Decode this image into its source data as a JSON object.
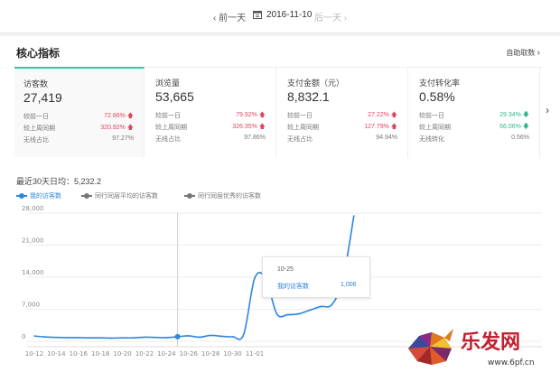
{
  "datebar": {
    "prev": "前一天",
    "date": "2016-11-10",
    "next": "后一天"
  },
  "panel": {
    "title": "核心指标",
    "custom": "自助取数"
  },
  "metrics": [
    {
      "name": "访客数",
      "value": "27,419",
      "rows": [
        {
          "label": "较前一日",
          "value": "72.86%",
          "dir": "up"
        },
        {
          "label": "较上周同期",
          "value": "320.92%",
          "dir": "up"
        },
        {
          "label": "无线占比",
          "value": "97.27%",
          "dir": "none"
        }
      ]
    },
    {
      "name": "浏览量",
      "value": "53,665",
      "rows": [
        {
          "label": "较前一日",
          "value": "79.92%",
          "dir": "up"
        },
        {
          "label": "较上周同期",
          "value": "326.35%",
          "dir": "up"
        },
        {
          "label": "无线占比",
          "value": "97.86%",
          "dir": "none"
        }
      ]
    },
    {
      "name": "支付金额（元）",
      "value": "8,832.1",
      "rows": [
        {
          "label": "较前一日",
          "value": "27.22%",
          "dir": "up"
        },
        {
          "label": "较上周同期",
          "value": "127.79%",
          "dir": "up"
        },
        {
          "label": "无线占比",
          "value": "94.94%",
          "dir": "none"
        }
      ]
    },
    {
      "name": "支付转化率",
      "value": "0.58%",
      "rows": [
        {
          "label": "较前一日",
          "value": "29.34%",
          "dir": "down"
        },
        {
          "label": "较上周同期",
          "value": "66.06%",
          "dir": "down"
        },
        {
          "label": "无线转化",
          "value": "0.56%",
          "dir": "none"
        }
      ]
    }
  ],
  "chart_header": {
    "avg": "最近30天日均：5,232.2"
  },
  "tooltip": {
    "date": "10-25",
    "label": "我的访客数",
    "value": "1,006"
  },
  "watermark": {
    "brand": "乐发网",
    "url": "www.6pf.cn"
  },
  "colors": {
    "line": "#2b86e0",
    "up": "#e0455f",
    "down": "#2eb985",
    "active_border": "#38c3a3"
  },
  "chart_data": {
    "type": "line",
    "title": "",
    "xlabel": "",
    "ylabel": "",
    "ylim": [
      0,
      28000
    ],
    "yticks": [
      0,
      7000,
      14000,
      21000,
      28000
    ],
    "ytick_labels": [
      "0",
      "7,000",
      "14,000",
      "21,000",
      "28,000"
    ],
    "xtick_labels": [
      "10-12",
      "10-14",
      "10-16",
      "10-18",
      "10-20",
      "10-22",
      "10-24",
      "10-26",
      "10-28",
      "10-30",
      "11-01"
    ],
    "legend": [
      "我的访客数",
      "同行同层平均的访客数",
      "同行同层优秀的访客数"
    ],
    "x": [
      "10-12",
      "10-13",
      "10-14",
      "10-15",
      "10-16",
      "10-17",
      "10-18",
      "10-19",
      "10-20",
      "10-21",
      "10-22",
      "10-23",
      "10-24",
      "10-25",
      "10-26",
      "10-27",
      "10-28",
      "10-29",
      "10-30",
      "10-31",
      "11-01",
      "11-02",
      "11-03",
      "11-04",
      "11-05",
      "11-06",
      "11-07",
      "11-08",
      "11-09",
      "11-10"
    ],
    "series": [
      {
        "name": "我的访客数",
        "values": [
          1150,
          950,
          850,
          800,
          800,
          750,
          750,
          700,
          750,
          750,
          900,
          850,
          800,
          1006,
          1200,
          900,
          1300,
          1100,
          1000,
          1500,
          13800,
          13700,
          6000,
          5800,
          6000,
          6800,
          7600,
          8000,
          13500,
          27419
        ]
      }
    ]
  }
}
